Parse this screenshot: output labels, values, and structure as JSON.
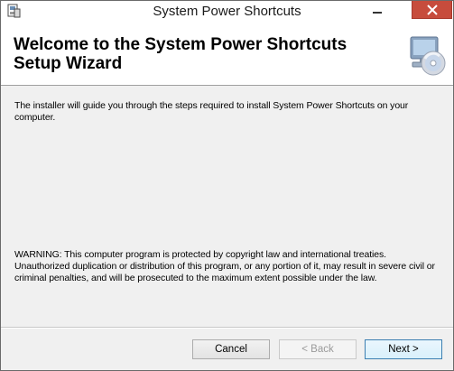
{
  "window": {
    "title": "System Power Shortcuts",
    "minimize_icon": "minimize-icon",
    "close_icon": "close-icon",
    "close_color": "#c74c3c"
  },
  "header": {
    "title": "Welcome to the System Power Shortcuts Setup Wizard",
    "icon": "computer-cd-icon"
  },
  "content": {
    "intro": "The installer will guide you through the steps required to install System Power Shortcuts on your computer.",
    "warning": "WARNING: This computer program is protected by copyright law and international treaties. Unauthorized duplication or distribution of this program, or any portion of it, may result in severe civil or criminal penalties, and will be prosecuted to the maximum extent possible under the law."
  },
  "buttons": {
    "cancel": "Cancel",
    "back": "< Back",
    "next": "Next >"
  }
}
